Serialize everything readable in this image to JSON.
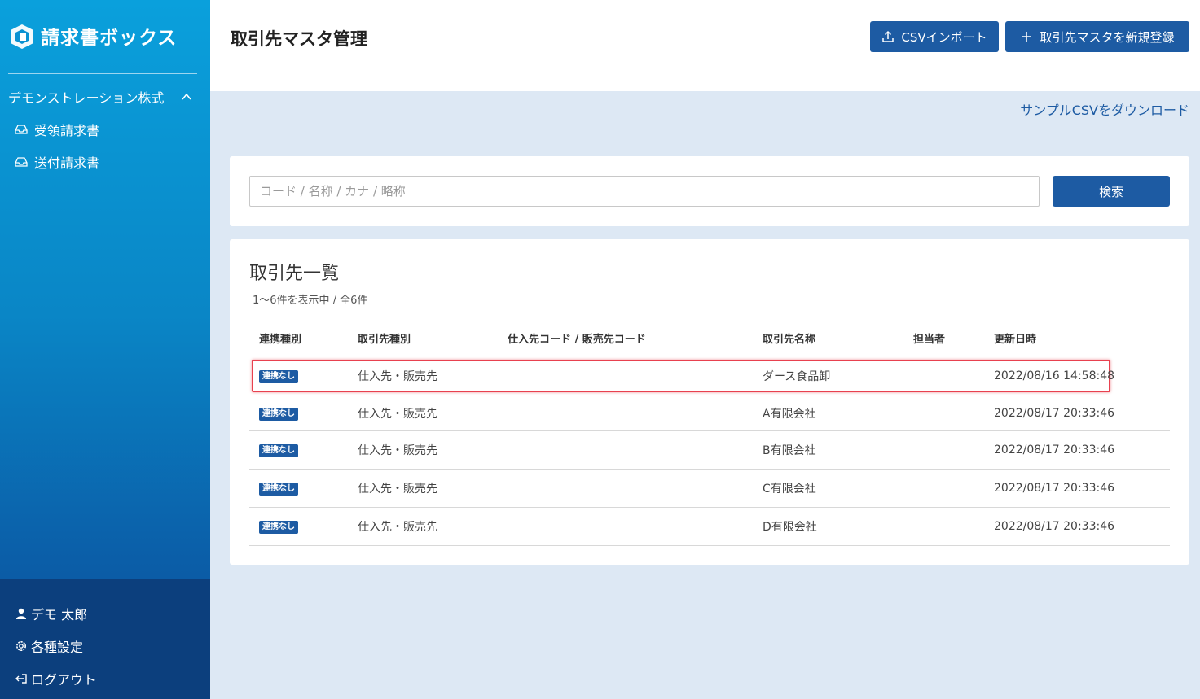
{
  "app": {
    "logo_text": "請求書ボックス",
    "company_name": "デモンストレーション株式",
    "nav": [
      {
        "label": "受領請求書",
        "icon": "inbox-icon"
      },
      {
        "label": "送付請求書",
        "icon": "inbox-icon"
      }
    ],
    "user": {
      "name": "デモ 太郎",
      "settings_label": "各種設定",
      "logout_label": "ログアウト"
    }
  },
  "header": {
    "title": "取引先マスタ管理",
    "csv_import_label": "CSVインポート",
    "new_label": "取引先マスタを新規登録"
  },
  "sample_csv_label": "サンプルCSVをダウンロード",
  "search": {
    "placeholder": "コード / 名称 / カナ / 略称",
    "button_label": "検索"
  },
  "list": {
    "title": "取引先一覧",
    "count_text": "1〜6件を表示中 / 全6件",
    "columns": [
      "連携種別",
      "取引先種別",
      "仕入先コード / 販売先コード",
      "取引先名称",
      "担当者",
      "更新日時"
    ],
    "rows": [
      {
        "link_type": "連携なし",
        "partner_type": "仕入先・販売先",
        "code": "",
        "name": "ダース食品卸",
        "owner": "",
        "updated": "2022/08/16 14:58:48"
      },
      {
        "link_type": "連携なし",
        "partner_type": "仕入先・販売先",
        "code": "",
        "name": "A有限会社",
        "owner": "",
        "updated": "2022/08/17 20:33:46"
      },
      {
        "link_type": "連携なし",
        "partner_type": "仕入先・販売先",
        "code": "",
        "name": "B有限会社",
        "owner": "",
        "updated": "2022/08/17 20:33:46"
      },
      {
        "link_type": "連携なし",
        "partner_type": "仕入先・販売先",
        "code": "",
        "name": "C有限会社",
        "owner": "",
        "updated": "2022/08/17 20:33:46"
      },
      {
        "link_type": "連携なし",
        "partner_type": "仕入先・販売先",
        "code": "",
        "name": "D有限会社",
        "owner": "",
        "updated": "2022/08/17 20:33:46"
      }
    ]
  },
  "colors": {
    "primary": "#1d5ba3",
    "highlight": "#e8414f",
    "background": "#dde8f4"
  }
}
